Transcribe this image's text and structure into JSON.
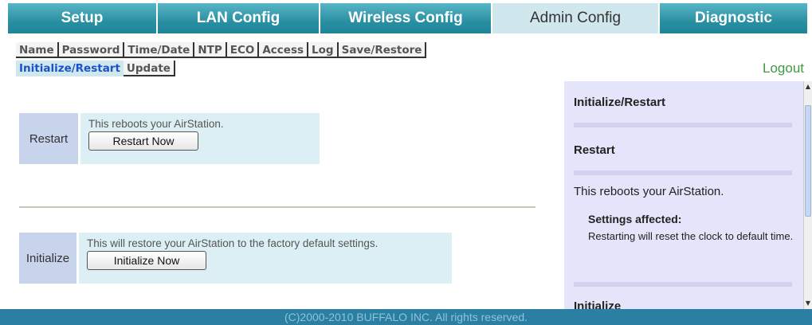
{
  "tabs": [
    {
      "label": "Setup",
      "active": false
    },
    {
      "label": "LAN Config",
      "active": false
    },
    {
      "label": "Wireless Config",
      "active": false
    },
    {
      "label": "Admin Config",
      "active": true
    },
    {
      "label": "Diagnostic",
      "active": false
    }
  ],
  "submenu": {
    "row1": [
      "Name",
      "Password",
      "Time/Date",
      "NTP",
      "ECO",
      "Access",
      "Log",
      "Save/Restore"
    ],
    "row2": [
      "Initialize/Restart",
      "Update"
    ],
    "current": "Initialize/Restart"
  },
  "logout_label": "Logout",
  "restart": {
    "label": "Restart",
    "description": "This reboots your AirStation.",
    "button": "Restart Now"
  },
  "initialize": {
    "label": "Initialize",
    "description": "This will restore your AirStation to the factory default settings.",
    "button": "Initialize Now"
  },
  "help": {
    "title": "Initialize/Restart",
    "restart_heading": "Restart",
    "restart_text": "This reboots your AirStation.",
    "settings_affected": "Settings affected:",
    "settings_text": "Restarting will reset the clock to default time.",
    "initialize_heading": "Initialize"
  },
  "footer": "(C)2000-2010 BUFFALO INC. All rights reserved.",
  "colors": {
    "tab_bg": "#2b8fa2",
    "tab_active_bg": "#cfe7ed",
    "submenu_current": "#1a53c9",
    "logout": "#3d9a3d",
    "help_bg": "#e4e4fa",
    "footer_bg": "#2b7fa2"
  }
}
